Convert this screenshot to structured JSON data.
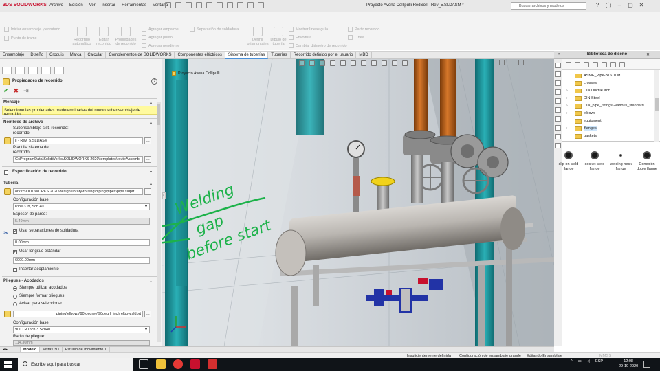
{
  "app": {
    "brand": "SOLIDWORKS",
    "brand_mark": "3DS",
    "document_title": "Proyecto Avena Collipulli RedSoil - Rev_5.SLDASM *",
    "search_placeholder": "Buscar archivos y modelos",
    "menus": [
      "Archivo",
      "Edición",
      "Ver",
      "Insertar",
      "Herramientas",
      "Ventana"
    ],
    "window_controls": {
      "help": "?",
      "user": "◯",
      "minimize": "–",
      "maximize": "▢",
      "close": "✕"
    }
  },
  "ribbon": {
    "group1": [
      "Iniciar ensamblaje y enrutado",
      "Punto de tramo"
    ],
    "big_buttons": [
      {
        "label": "Recorrido automático"
      },
      {
        "label": "Editar recorrido"
      },
      {
        "label": "Propiedades de recorrido"
      }
    ],
    "group2": [
      "Agregar empalme",
      "Agregar punto",
      "Agregar pendiente"
    ],
    "group3": [
      "Separación de soldadura"
    ],
    "big_buttons2": [
      {
        "label": "Definir prismontajes"
      },
      {
        "label": "Dibujo de tubería"
      }
    ],
    "group4": [
      "Mostrar líneas guía",
      "Envoltura",
      "Cambiar diámetro de recorrido"
    ],
    "group5": [
      "Partir recorrido",
      "Línea"
    ]
  },
  "tabs": [
    "Ensamblaje",
    "Diseño",
    "Croquis",
    "Marca",
    "Calcular",
    "Complementos de SOLIDWORKS",
    "Componentes eléctricos",
    "Sistema de tuberías",
    "Tuberías",
    "Recorrido definido por el usuario",
    "MBD"
  ],
  "active_tab_index": 7,
  "property_manager": {
    "title": "Propiedades de recorrido",
    "help": "?",
    "ok": "✔",
    "cancel": "✖",
    "pin": "⇥",
    "mensaje_header": "Mensaje",
    "mensaje_text": "Seleccione las propiedades predeterminadas del nuevo subensamblaje de recorrido.",
    "archivo_header": "Nombres de archivo",
    "subensamblaje_label": "Subensamblaje sist. recorrido:",
    "subensamblaje_label2": "recorrido:",
    "subensamblaje_value": "ll - Rev_5.SLDASM",
    "plantilla_label": "Plantilla sistema de",
    "plantilla_label2": "recorrido:",
    "plantilla_value": "C:\\ProgramData\\SolidWorks\\SOLIDWORKS 2020\\templates\\routeAssemb",
    "especificacion_label": "Especificación de recorrido",
    "tuberia_header": "Tubería",
    "tuberia_path": "orks\\SOLIDWORKS 2020\\design library\\routing\\piping\\pipes\\pipe.sldprt",
    "config_base_label": "Configuración base:",
    "config_base_value": "Pipe 3 in, Sch 40",
    "espesor_label": "Espesor de pared:",
    "espesor_value": "5.49mm",
    "usar_separaciones_label": "Usar separaciones de soldadura",
    "separacion_value": "0.00mm",
    "usar_longitud_label": "Usar longitud estándar",
    "longitud_value": "6000.00mm",
    "insertar_label": "Insertar acoplamiento",
    "pliegues_header": "Pliegues - Acodados",
    "radio1": "Siempre utilizar acodados",
    "radio2": "Siempre formar pliegues",
    "radio3": "Avisar para seleccionar",
    "codo_path": "piping\\elbows\\90 degree\\90deg lr inch elbow.sldprt",
    "config_base2_label": "Configuración base:",
    "config_base2_value": "90L LR Inch 3 Sch40",
    "radio_pliegue_label": "Radio de pliegue:",
    "radio_pliegue_value": "114.30mm"
  },
  "viewport": {
    "tree_label": "Proyecto Avena Collipulli ...",
    "annotation_lines": [
      "Welding",
      "gap",
      "before start"
    ]
  },
  "design_library": {
    "header": "Biblioteca de diseño",
    "collapse": "»",
    "close": "✕",
    "tree": [
      "ASME_Pipe-B16.10M",
      "crosses",
      "DIN Ductile Iron",
      "DIN Steel",
      "DIN_pipe_fittings--various_standard",
      "elbows",
      "equipment",
      "flanges",
      "gaskets"
    ],
    "selected_index": 7,
    "items": [
      {
        "label": "slip on weld flange"
      },
      {
        "label": "socket weld flange"
      },
      {
        "label": "welding neck flange"
      },
      {
        "label": "Conexión doble flange"
      }
    ]
  },
  "bottom_tabs": [
    "Modelo",
    "Vistas 3D",
    "Estudio de movimiento 1"
  ],
  "status": {
    "s1": "Insuficientemente definida",
    "s2": "Configuración de ensamblaje grande",
    "s3": "Editando Ensamblaje",
    "s4": "MMGS"
  },
  "taskbar": {
    "search_text": "Escribe aquí para buscar",
    "lang": "ESP",
    "time": "12:08",
    "date": "29-10-2020"
  },
  "colors": {
    "annotation": "#1db24a",
    "pipe_orange": "#c46a1e",
    "tank_gray": "#b3b0ac",
    "frame_gray": "#b9b9b9",
    "teal": "#1a9aa0",
    "valve_blue": "#2233a6",
    "message_bg": "#fffa9e",
    "accent": "#4a90d9"
  }
}
